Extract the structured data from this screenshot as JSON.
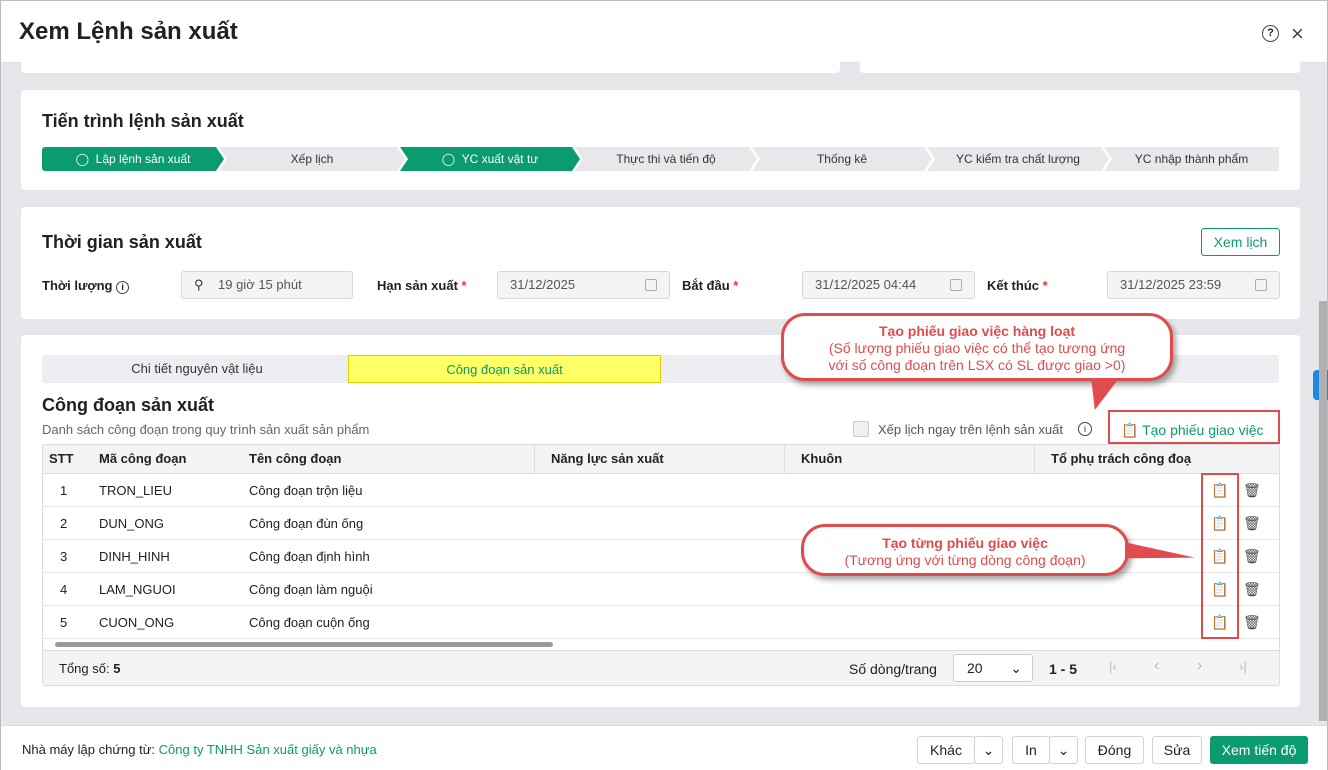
{
  "title": "Xem Lệnh sản xuất",
  "progress": {
    "title": "Tiến trình lệnh sản xuất",
    "steps": [
      {
        "label": "Lập lệnh sản xuất",
        "done": true
      },
      {
        "label": "Xếp lịch",
        "done": false
      },
      {
        "label": "YC xuất vật tư",
        "done": true
      },
      {
        "label": "Thực thi và tiến độ",
        "done": false
      },
      {
        "label": "Thống kê",
        "done": false
      },
      {
        "label": "YC kiểm tra chất lượng",
        "done": false
      },
      {
        "label": "YC nhập thành phẩm",
        "done": false
      }
    ]
  },
  "time": {
    "title": "Thời gian sản xuất",
    "view_calendar": "Xem lịch",
    "duration_label": "Thời lượng",
    "duration_value": "19 giờ 15 phút",
    "deadline_label": "Hạn sản xuất",
    "deadline_value": "31/12/2025",
    "start_label": "Bắt đầu",
    "start_value": "31/12/2025 04:44",
    "end_label": "Kết thúc",
    "end_value": "31/12/2025 23:59",
    "required": "*"
  },
  "tabs": [
    {
      "label": "Chi tiết nguyên vật liệu"
    },
    {
      "label": "Công đoạn sản xuất"
    }
  ],
  "stages": {
    "title": "Công đoạn sản xuất",
    "subtitle": "Danh sách công đoạn trong quy trình sản xuất sản phẩm",
    "schedule_checkbox": "Xếp lịch ngay trên lệnh sản xuất",
    "create_button": "Tạo phiếu giao việc",
    "columns": [
      "STT",
      "Mã công đoạn",
      "Tên công đoạn",
      "Năng lực sản xuất",
      "Khuôn",
      "Tổ phụ trách công đoạ"
    ],
    "rows": [
      [
        "1",
        "TRON_LIEU",
        "Công đoạn trộn liệu"
      ],
      [
        "2",
        "DUN_ONG",
        "Công đoạn đùn ống"
      ],
      [
        "3",
        "DINH_HINH",
        "Công đoạn định hình"
      ],
      [
        "4",
        "LAM_NGUOI",
        "Công đoạn làm nguội"
      ],
      [
        "5",
        "CUON_ONG",
        "Công đoạn cuộn ống"
      ]
    ],
    "total_label": "Tổng số:",
    "total": "5",
    "page_size_label": "Số dòng/trang",
    "page_size": "20",
    "range": "1 - 5"
  },
  "callouts": {
    "bulk_title": "Tạo phiếu giao việc hàng loạt",
    "bulk_line1": "(Số lượng phiếu giao việc có thể tạo tương ứng",
    "bulk_line2": "với số công đoạn trên LSX có SL được giao >0)",
    "single_title": "Tạo từng phiếu giao việc",
    "single_line1": "(Tương ứng với từng dòng công đoạn)"
  },
  "footer": {
    "factory_label": "Nhà máy lập chứng từ:",
    "factory": "Công ty TNHH Sản xuất giấy và nhựa",
    "other": "Khác",
    "print": "In",
    "close": "Đóng",
    "edit": "Sửa",
    "progress": "Xem tiến độ"
  },
  "colors": {
    "accent": "#0a9b6e",
    "annotation": "#e04b4b",
    "highlight": "#ffff66"
  }
}
